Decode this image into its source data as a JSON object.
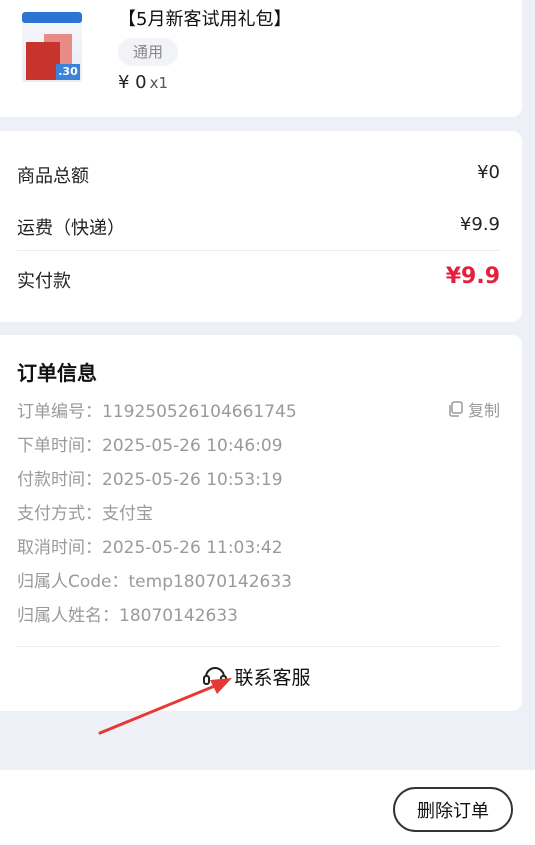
{
  "product": {
    "title": "【5月新客试用礼包】",
    "tag": "通用",
    "price": "¥ 0",
    "qty": "x1",
    "thumb_label": ".30"
  },
  "summary": {
    "goods_total_label": "商品总额",
    "goods_total_value": "¥0",
    "shipping_label": "运费（快递）",
    "shipping_value": "¥9.9",
    "paid_label": "实付款",
    "paid_value": "¥9.9"
  },
  "order_info": {
    "title": "订单信息",
    "order_no": "订单编号：119250526104661745",
    "copy_label": "复制",
    "order_time": "下单时间：2025-05-26 10:46:09",
    "pay_time": "付款时间：2025-05-26 10:53:19",
    "pay_method": "支付方式：支付宝",
    "cancel_time": "取消时间：2025-05-26 11:03:42",
    "owner_code": "归属人Code：temp18070142633",
    "owner_name": "归属人姓名：18070142633",
    "contact_label": "联系客服"
  },
  "footer": {
    "delete_label": "删除订单"
  },
  "colors": {
    "accent_price": "#e3203d",
    "annotation_arrow": "#e53935"
  }
}
